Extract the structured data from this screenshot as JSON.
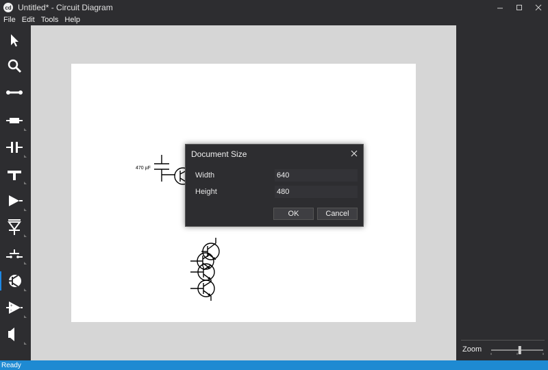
{
  "window": {
    "title": "Untitled* - Circuit Diagram"
  },
  "menu": {
    "items": [
      "File",
      "Edit",
      "Tools",
      "Help"
    ]
  },
  "toolbox": {
    "tools": [
      {
        "name": "select",
        "icon": "arrow-pointer-icon"
      },
      {
        "name": "zoom",
        "icon": "magnifier-icon"
      },
      {
        "name": "wire",
        "icon": "wire-icon"
      },
      {
        "name": "resistor",
        "icon": "resistor-icon"
      },
      {
        "name": "capacitor",
        "icon": "capacitor-icon"
      },
      {
        "name": "ground",
        "icon": "ground-icon"
      },
      {
        "name": "diode",
        "icon": "diode-icon"
      },
      {
        "name": "led",
        "icon": "led-icon"
      },
      {
        "name": "switch",
        "icon": "push-switch-icon"
      },
      {
        "name": "transistor",
        "icon": "transistor-icon"
      },
      {
        "name": "opamp",
        "icon": "opamp-icon"
      },
      {
        "name": "speaker",
        "icon": "speaker-icon"
      }
    ]
  },
  "circuit": {
    "capacitor_label": "470 µF"
  },
  "dialog": {
    "title": "Document Size",
    "width_label": "Width",
    "width_value": "640",
    "height_label": "Height",
    "height_value": "480",
    "ok_label": "OK",
    "cancel_label": "Cancel"
  },
  "zoom": {
    "label": "Zoom",
    "level": 0.55
  },
  "status": {
    "text": "Ready"
  },
  "colors": {
    "accent": "#1e8ad2",
    "chrome": "#2d2d30",
    "canvas": "#d6d6d6"
  }
}
